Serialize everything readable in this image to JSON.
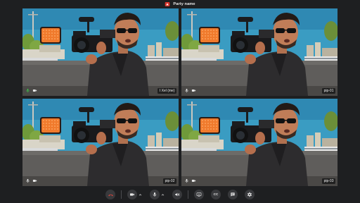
{
  "window": {
    "title": "Party name",
    "accent_color": "#d9342b"
  },
  "participants": [
    {
      "name": "I Xel (me)",
      "mic_icon": "mic-active-icon",
      "camera_icon": "camera-icon"
    },
    {
      "name": "pip-01",
      "mic_icon": "mic-icon",
      "camera_icon": "camera-icon"
    },
    {
      "name": "pip-02",
      "mic_icon": "mic-icon",
      "camera_icon": "camera-icon"
    },
    {
      "name": "pip-03",
      "mic_icon": "mic-icon",
      "camera_icon": "camera-icon"
    }
  ],
  "controls": {
    "end_call_icon": "end-call-icon",
    "camera_icon": "camera-icon",
    "microphone_icon": "microphone-icon",
    "volume_icon": "volume-icon",
    "share_screen_icon": "share-screen-icon",
    "captions_label": "CC",
    "chat_icon": "chat-icon",
    "settings_icon": "settings-icon"
  },
  "colors": {
    "end_call": "#e0463c",
    "mic_active": "#3fbf4a",
    "control_bg": "#38393c"
  }
}
